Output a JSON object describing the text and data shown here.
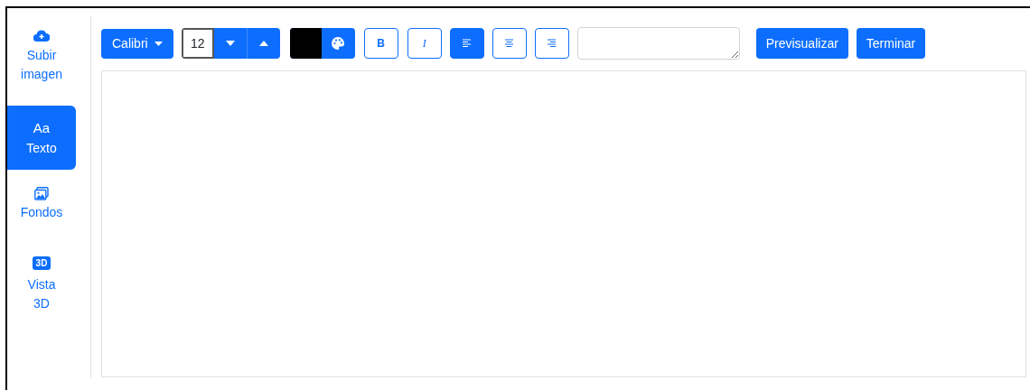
{
  "sidebar": {
    "items": [
      {
        "kind": "upload",
        "label": "Subir imagen",
        "selected": false
      },
      {
        "kind": "text",
        "glyph": "Aa",
        "label": "Texto",
        "selected": true
      },
      {
        "kind": "backgrounds",
        "label": "Fondos",
        "selected": false
      },
      {
        "kind": "view3d",
        "glyph": "3D",
        "label": "Vista 3D",
        "selected": false
      }
    ]
  },
  "toolbar": {
    "font": "Calibri",
    "font_size": "12",
    "color_swatch": {
      "color": "#000000"
    },
    "styles": [
      {
        "kind": "bold",
        "label": "B",
        "selected": false
      },
      {
        "kind": "italic",
        "label": "I",
        "selected": false
      }
    ],
    "alignments": [
      {
        "kind": "left",
        "selected": true
      },
      {
        "kind": "center",
        "selected": false
      },
      {
        "kind": "right",
        "selected": false
      }
    ],
    "buttons": [
      "Previsualizar",
      "Terminar"
    ]
  }
}
